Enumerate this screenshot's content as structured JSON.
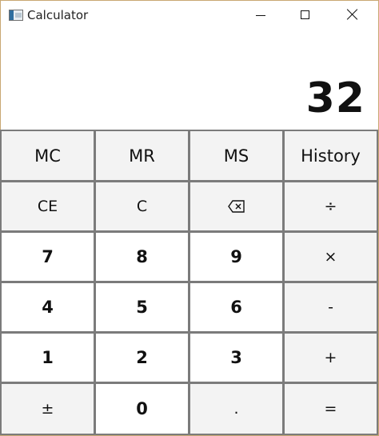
{
  "window": {
    "title": "Calculator",
    "icon": "calculator-app-icon",
    "controls": {
      "minimize": "minimize-icon",
      "maximize": "maximize-icon",
      "close": "close-icon"
    }
  },
  "display": {
    "value": "32"
  },
  "keys": {
    "mc": "MC",
    "mr": "MR",
    "ms": "MS",
    "history": "History",
    "ce": "CE",
    "c": "C",
    "divide": "÷",
    "seven": "7",
    "eight": "8",
    "nine": "9",
    "multiply": "×",
    "four": "4",
    "five": "5",
    "six": "6",
    "minus": "-",
    "one": "1",
    "two": "2",
    "three": "3",
    "plus": "+",
    "plus_minus": "±",
    "zero": "0",
    "decimal": ".",
    "equals": "=",
    "backspace_icon": "backspace-icon"
  },
  "colors": {
    "window_border": "#c9a873",
    "key_border": "#7b7b7b",
    "number_key": "#ffffff",
    "function_key": "#f3f3f3",
    "text": "#111111"
  }
}
